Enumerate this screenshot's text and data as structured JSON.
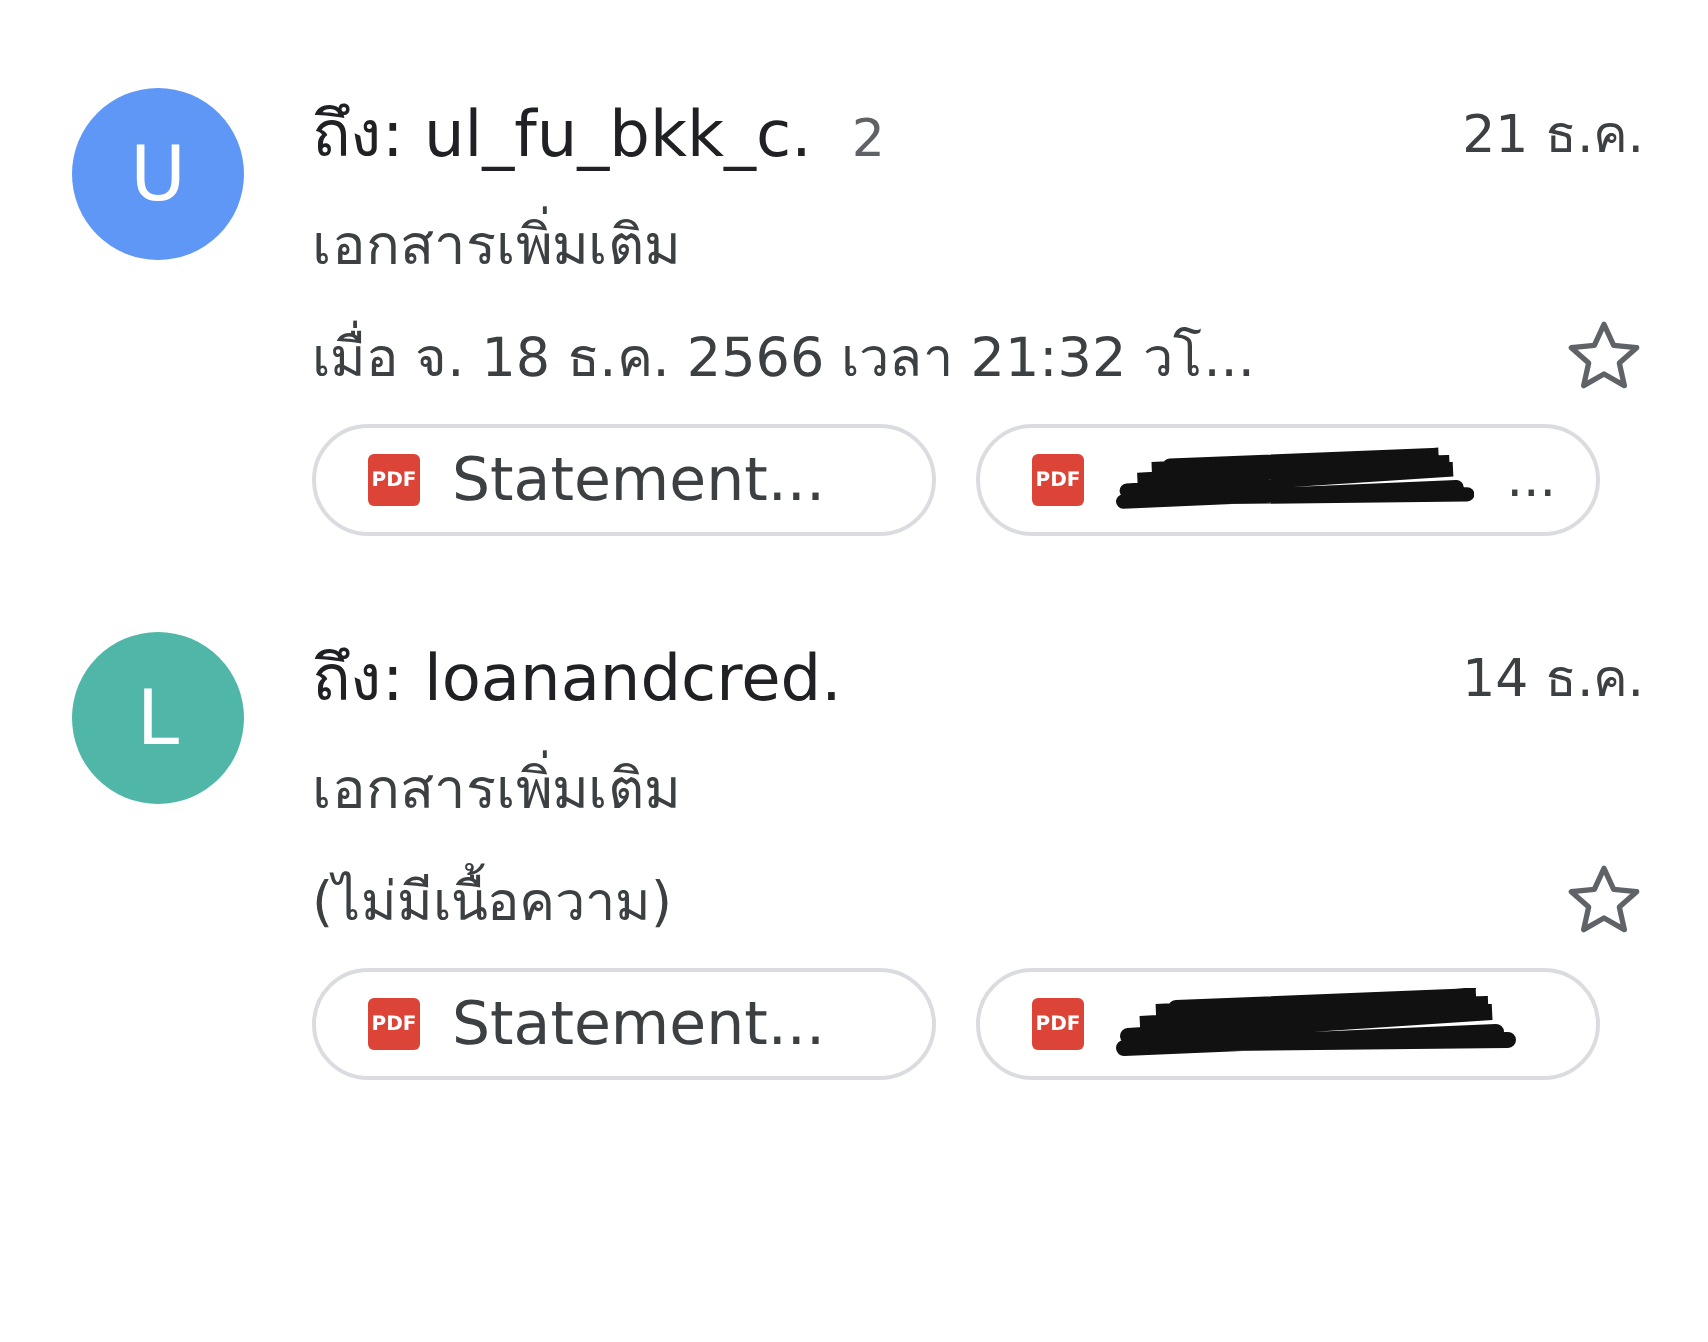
{
  "emails": [
    {
      "avatar_letter": "U",
      "color": "#5f97f6",
      "sender": "ถึง: ul_fu_bkk_c.",
      "count": "2",
      "date": "21 ธ.ค.",
      "subject": "เอกสารเพิ่มเติม",
      "snippet": "เมื่อ จ. 18 ธ.ค. 2566 เวลา 21:32 วโ...",
      "starred": false,
      "attachments": [
        {
          "kind": "file",
          "icon_label": "PDF",
          "name": "Statement..."
        },
        {
          "kind": "redacted",
          "icon_label": "PDF",
          "name": "..."
        }
      ]
    },
    {
      "avatar_letter": "L",
      "color": "#4fb6a8",
      "sender": "ถึง: loanandcred.",
      "date": "14 ธ.ค.",
      "subject": "เอกสารเพิ่มเติม",
      "snippet": "(ไม่มีเนื้อความ)",
      "starred": false,
      "attachments": [
        {
          "kind": "file",
          "icon_label": "PDF",
          "name": "Statement..."
        },
        {
          "kind": "redacted",
          "icon_label": "PDF"
        }
      ]
    }
  ]
}
